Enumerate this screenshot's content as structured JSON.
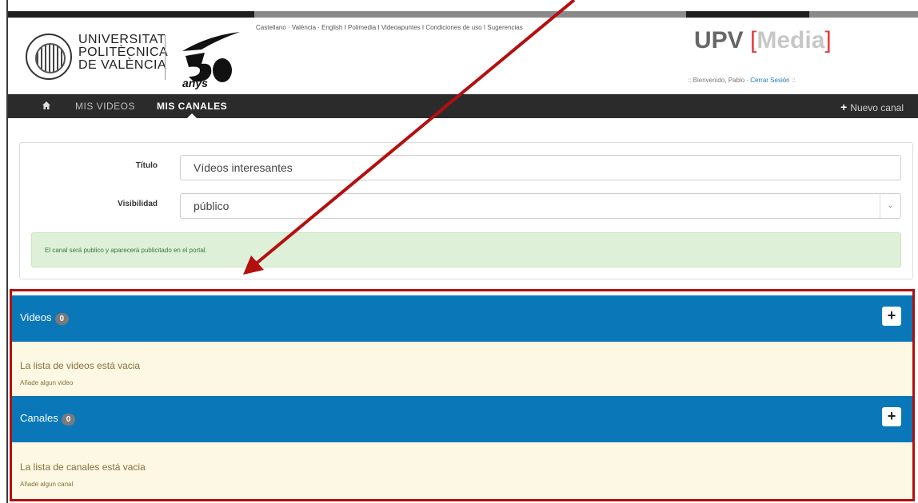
{
  "header": {
    "university_name_lines": [
      "UNIVERSITAT",
      "POLITÈCNICA",
      "DE VALÈNCIA"
    ],
    "anniversary_logo_text": "anys",
    "top_links": [
      "Castellano",
      "València",
      "English",
      "Polimedia",
      "Videoapuntes",
      "Condiciones de uso",
      "Sugerencias"
    ],
    "brand": {
      "upv": "UPV",
      "media": "Media"
    },
    "welcome": {
      "prefix": ":: Bienvenido, Pablo ·",
      "logout": "Cerrar Sesión",
      "suffix": "::"
    }
  },
  "navbar": {
    "home_icon": "home-icon",
    "items": [
      {
        "label": "MIS VIDEOS",
        "active": false
      },
      {
        "label": "MIS CANALES",
        "active": true
      }
    ],
    "new_channel": {
      "icon": "plus-icon",
      "label": "Nuevo canal"
    }
  },
  "form": {
    "title_label": "Título",
    "title_value": "Vídeos interesantes",
    "visibility_label": "Visibilidad",
    "visibility_value": "público",
    "alert": "El canal será publico y aparecerá publicitado en el portal."
  },
  "sections": {
    "videos": {
      "title": "Videos",
      "count": "0",
      "add_label": "+",
      "empty_title": "La lista de videos está vacia",
      "empty_sub": "Añade algun video"
    },
    "channels": {
      "title": "Canales",
      "count": "0",
      "add_label": "+",
      "empty_title": "La lista de canales está vacia",
      "empty_sub": "Añade algun canal"
    }
  },
  "colors": {
    "accent_blue": "#0a78b8",
    "annotation_red": "#b40f0f",
    "navbar": "#2b2b2b",
    "empty_bg": "#fcf8e3",
    "alert_bg": "#dff0d8"
  }
}
